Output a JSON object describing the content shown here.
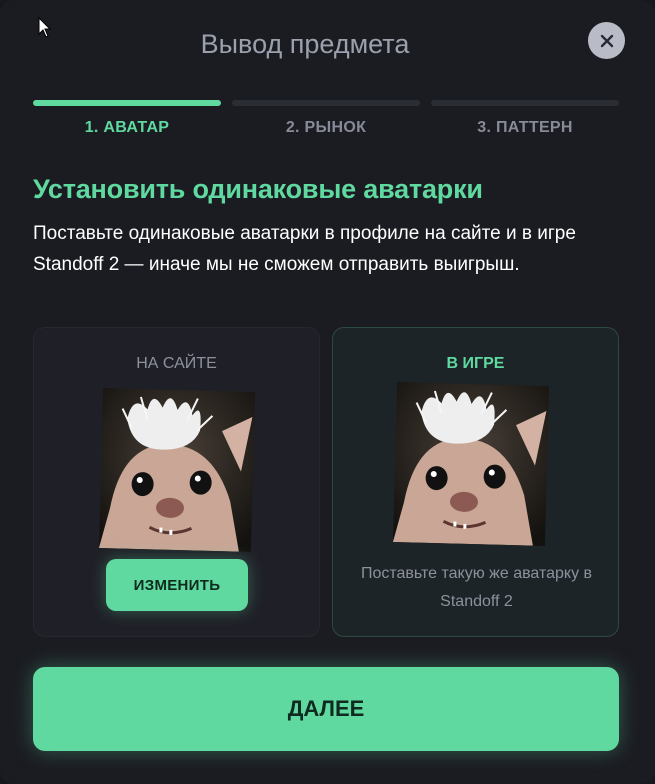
{
  "modal": {
    "title": "Вывод предмета",
    "close_icon": "close-icon"
  },
  "steps": [
    {
      "label": "1. АВАТАР",
      "active": true
    },
    {
      "label": "2. РЫНОК",
      "active": false
    },
    {
      "label": "3. ПАТТЕРН",
      "active": false
    }
  ],
  "heading": "Установить одинаковые аватарки",
  "description": "Поставьте одинаковые аватарки в профиле на сайте и в игре Standoff 2 — иначе мы не сможем отправить выигрыш.",
  "cards": {
    "site": {
      "title": "НА САЙТЕ",
      "button_label": "ИЗМЕНИТЬ"
    },
    "game": {
      "title": "В ИГРЕ",
      "hint": "Поставьте такую же аватарку в Standoff 2"
    }
  },
  "next_button": "ДАЛЕЕ",
  "colors": {
    "accent": "#5fd9a0",
    "background": "#1b1c22",
    "muted": "#8d919d"
  }
}
